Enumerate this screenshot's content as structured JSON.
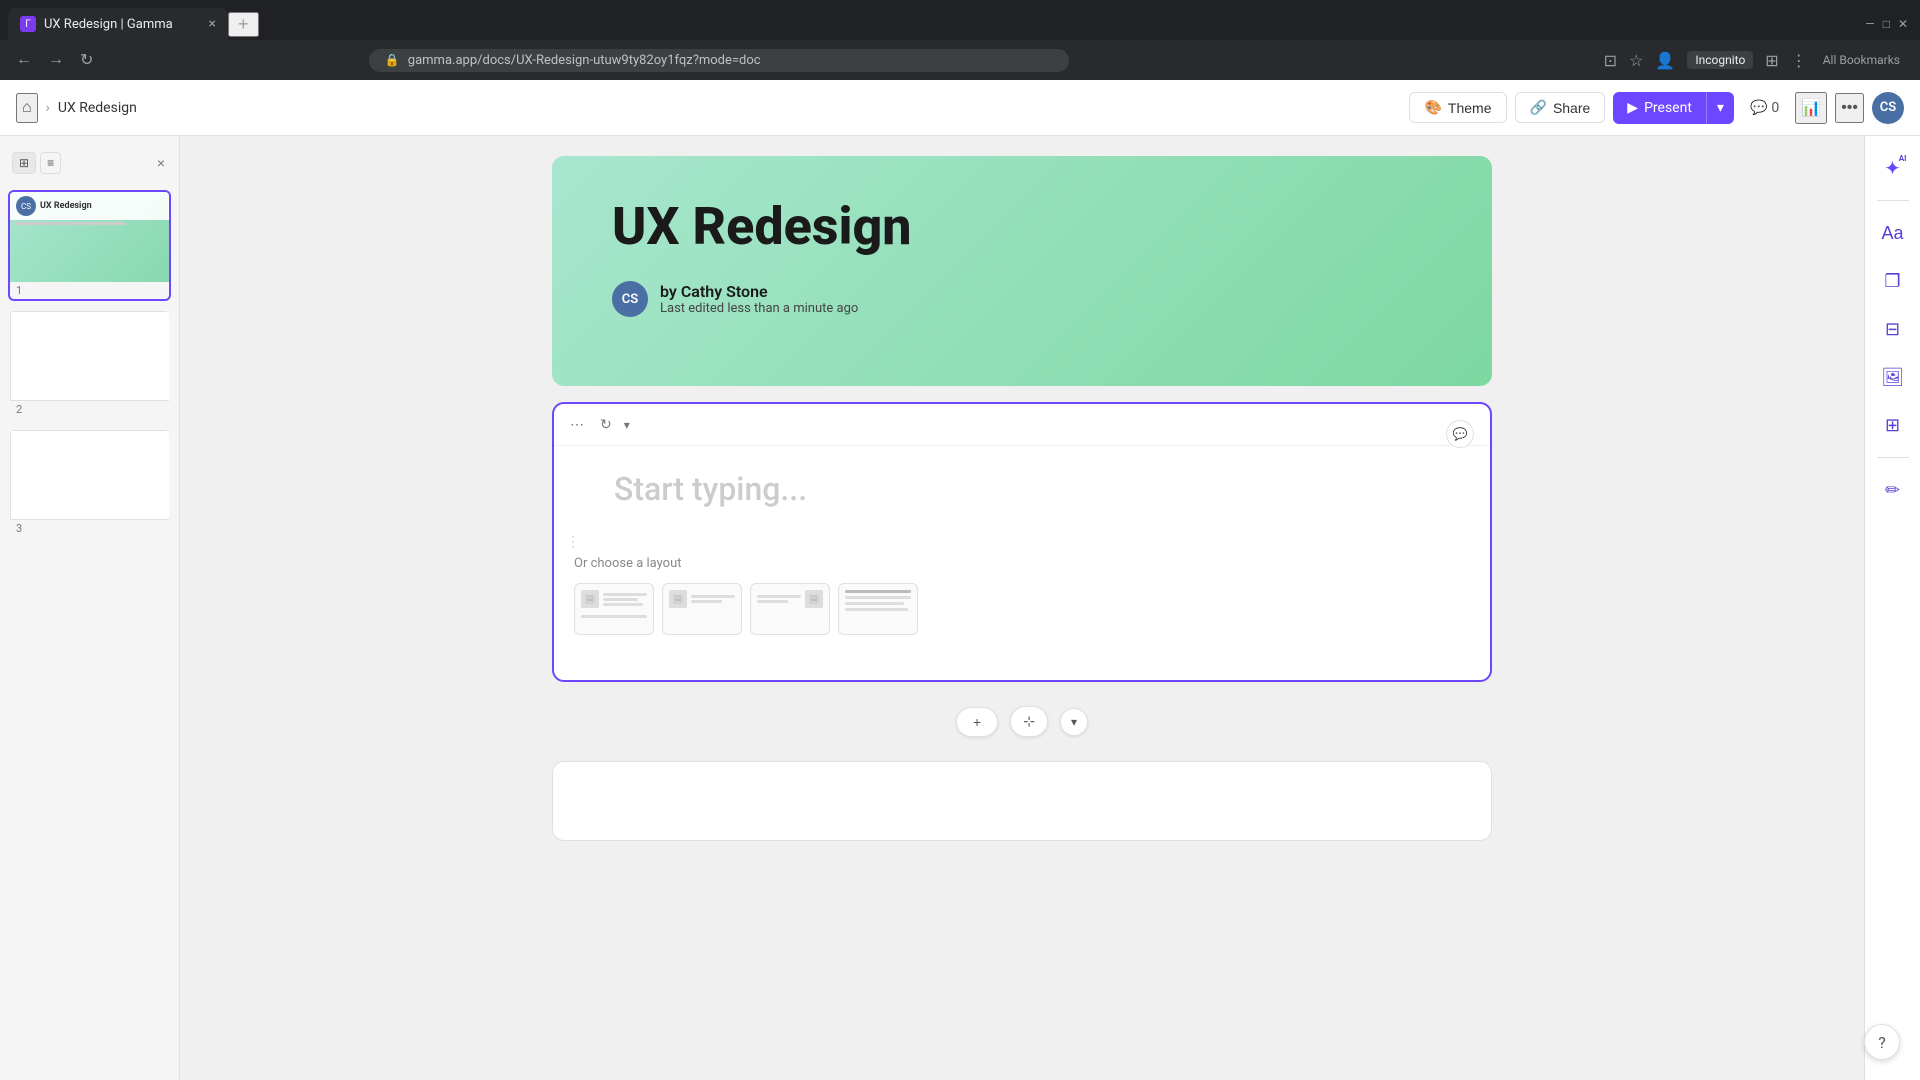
{
  "browser": {
    "tab_title": "UX Redesign | Gamma",
    "tab_favicon": "Γ",
    "address": "gamma.app/docs/UX-Redesign-utuw9ty82oy1fqz?mode=doc",
    "incognito_label": "Incognito",
    "bookmarks_label": "All Bookmarks"
  },
  "toolbar": {
    "home_label": "⌂",
    "breadcrumb_sep": "›",
    "breadcrumb_home": "",
    "breadcrumb_item": "UX Redesign",
    "theme_label": "Theme",
    "share_label": "Share",
    "present_label": "Present",
    "comment_count": "0",
    "avatar_initials": "CS"
  },
  "sidebar": {
    "close_label": "×",
    "slide_1_label": "UX Redesign",
    "slide_1_number": "1",
    "slide_2_number": "2",
    "slide_3_number": "3"
  },
  "slide_hero": {
    "title": "UX Redesign",
    "author_initials": "CS",
    "author_name": "by Cathy Stone",
    "author_subtitle": "Last edited less than a minute ago"
  },
  "slide_editable": {
    "placeholder": "Start typing...",
    "layout_label": "Or choose a layout"
  },
  "add_slide_bar": {
    "add_label": "+",
    "arrange_label": "⊹",
    "dropdown_label": "▾"
  },
  "right_panel": {
    "ai_label": "✦",
    "ai_sup": "AI",
    "style_label": "Aa",
    "card_label": "❐",
    "table_label": "⊞",
    "image_label": "🖼",
    "grid_label": "⊟",
    "edit_label": "✏"
  },
  "help": {
    "label": "?"
  }
}
